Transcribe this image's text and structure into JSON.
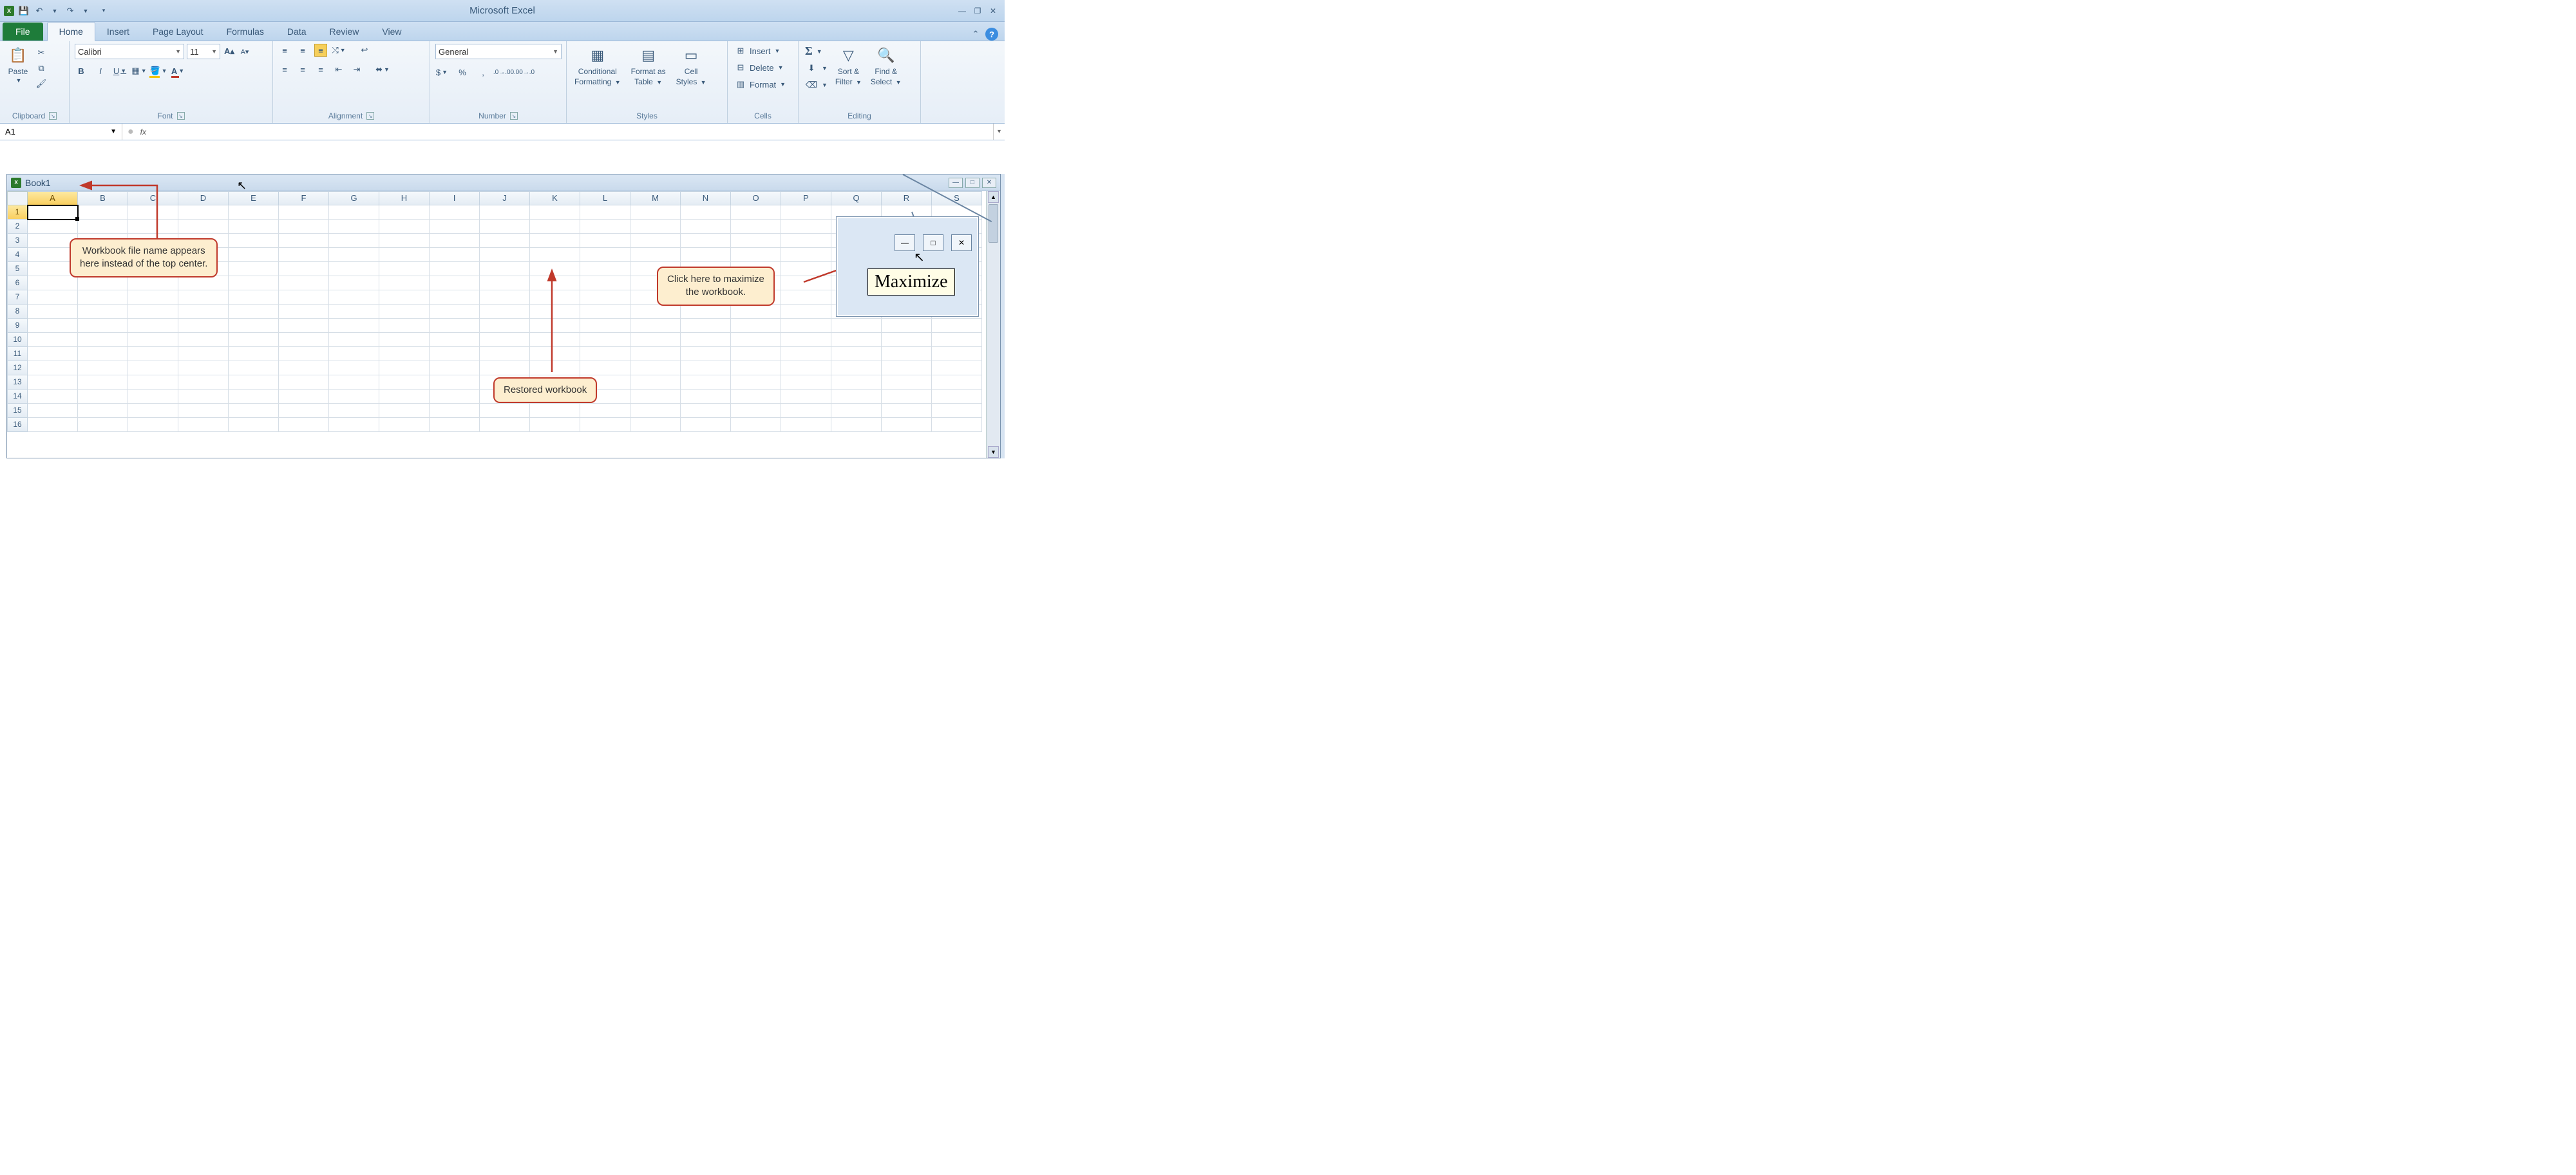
{
  "app_title": "Microsoft Excel",
  "qat": {
    "save": "💾",
    "undo": "↶",
    "redo": "↷"
  },
  "tabs": {
    "file": "File",
    "home": "Home",
    "insert": "Insert",
    "page_layout": "Page Layout",
    "formulas": "Formulas",
    "data": "Data",
    "review": "Review",
    "view": "View"
  },
  "ribbon": {
    "clipboard": {
      "label": "Clipboard",
      "paste": "Paste"
    },
    "font": {
      "label": "Font",
      "name": "Calibri",
      "size": "11"
    },
    "alignment": {
      "label": "Alignment"
    },
    "number": {
      "label": "Number",
      "format": "General"
    },
    "styles": {
      "label": "Styles",
      "conditional_l1": "Conditional",
      "conditional_l2": "Formatting",
      "table_l1": "Format as",
      "table_l2": "Table",
      "cell_l1": "Cell",
      "cell_l2": "Styles"
    },
    "cells": {
      "label": "Cells",
      "insert": "Insert",
      "delete": "Delete",
      "format": "Format"
    },
    "editing": {
      "label": "Editing",
      "sort_l1": "Sort &",
      "sort_l2": "Filter",
      "find_l1": "Find &",
      "find_l2": "Select"
    }
  },
  "name_box": "A1",
  "fx": "fx",
  "workbook_title": "Book1",
  "columns": [
    "A",
    "B",
    "C",
    "D",
    "E",
    "F",
    "G",
    "H",
    "I",
    "J",
    "K",
    "L",
    "M",
    "N",
    "O",
    "P",
    "Q",
    "R",
    "S"
  ],
  "rows": [
    "1",
    "2",
    "3",
    "4",
    "5",
    "6",
    "7",
    "8",
    "9",
    "10",
    "11",
    "12",
    "13",
    "14",
    "15",
    "16"
  ],
  "callouts": {
    "filename_l1": "Workbook file name appears",
    "filename_l2": "here instead of the top center.",
    "maximize_l1": "Click here to maximize",
    "maximize_l2": "the workbook.",
    "restored": "Restored workbook"
  },
  "inset_tooltip": "Maximize"
}
